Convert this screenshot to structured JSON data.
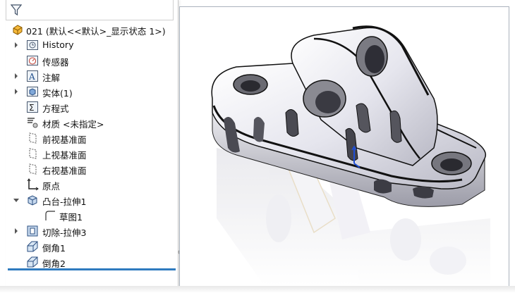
{
  "tree": {
    "root_label": "021  (默认<<默认>_显示状态 1>)",
    "items": [
      {
        "label": "History",
        "icon": "history-icon",
        "expandable": true
      },
      {
        "label": "传感器",
        "icon": "sensor-icon",
        "expandable": false
      },
      {
        "label": "注解",
        "icon": "annotation-icon",
        "expandable": true
      },
      {
        "label": "实体(1)",
        "icon": "solid-bodies-icon",
        "expandable": true
      },
      {
        "label": "方程式",
        "icon": "equations-icon",
        "expandable": false
      },
      {
        "label": "材质 <未指定>",
        "icon": "material-icon",
        "expandable": false
      },
      {
        "label": "前视基准面",
        "icon": "plane-icon",
        "expandable": false
      },
      {
        "label": "上视基准面",
        "icon": "plane-icon",
        "expandable": false
      },
      {
        "label": "右视基准面",
        "icon": "plane-icon",
        "expandable": false
      },
      {
        "label": "原点",
        "icon": "origin-icon",
        "expandable": false
      },
      {
        "label": "凸台-拉伸1",
        "icon": "extrude-boss-icon",
        "expandable": true,
        "expanded": true
      },
      {
        "label": "草图1",
        "icon": "sketch-icon",
        "child": true
      },
      {
        "label": "切除-拉伸3",
        "icon": "extrude-cut-icon",
        "expandable": true
      },
      {
        "label": "倒角1",
        "icon": "chamfer-icon",
        "expandable": false
      },
      {
        "label": "倒角2",
        "icon": "chamfer-icon",
        "expandable": false
      }
    ]
  },
  "colors": {
    "accent": "#2f7bbf",
    "panel_border": "#c9c9c9",
    "viewport_border": "#aab2bc"
  }
}
